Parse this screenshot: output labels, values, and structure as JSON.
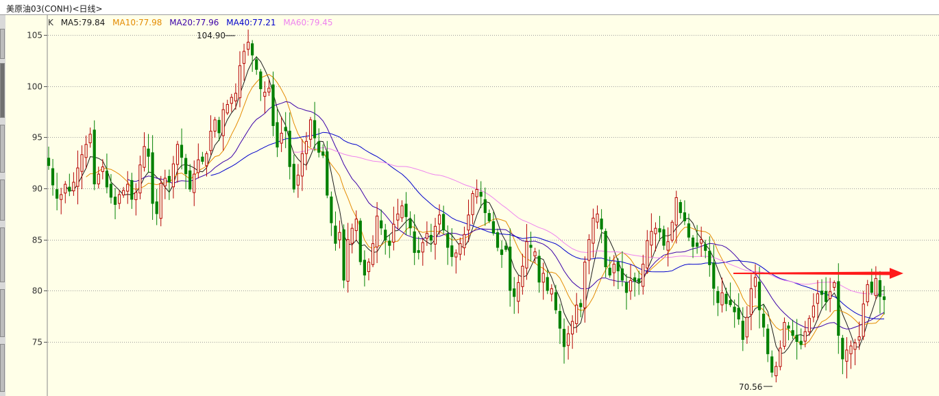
{
  "window": {
    "title": "美原油03(CONH)<日线>"
  },
  "legend": {
    "k_label": "K",
    "items": [
      {
        "label": "MA5:79.84",
        "color": "#1a1a1a"
      },
      {
        "label": "MA10:77.98",
        "color": "#e38b00"
      },
      {
        "label": "MA20:77.96",
        "color": "#3b00a8"
      },
      {
        "label": "MA40:77.21",
        "color": "#0000cc"
      },
      {
        "label": "MA60:79.45",
        "color": "#ee82ee"
      }
    ]
  },
  "colors": {
    "background": "#ffffe8",
    "up_candle": "#b50000",
    "down_candle": "#008000",
    "grid": "#9c9c9c",
    "arrow": "#ff1a1a"
  },
  "chart_data": {
    "type": "candlestick",
    "title": "美原油03(CONH)<日线>",
    "ylim": [
      70,
      106
    ],
    "y_ticks": [
      105,
      100,
      95,
      90,
      85,
      80,
      75
    ],
    "grid": "horizontal dotted",
    "annotations": [
      {
        "text": "104.90",
        "role": "period high"
      },
      {
        "text": "70.56",
        "role": "period low"
      },
      {
        "text": "",
        "role": "red horizontal arrow pointing right near 81.7"
      }
    ],
    "close": [
      92.2,
      90.3,
      89.0,
      89.4,
      90.4,
      89.7,
      90.6,
      92.0,
      93.3,
      94.3,
      95.3,
      90.4,
      91.4,
      92.1,
      90.1,
      89.1,
      88.4,
      89.4,
      89.8,
      90.4,
      88.9,
      89.6,
      92.3,
      94.1,
      93.1,
      88.5,
      87.5,
      90.5,
      91.0,
      90.6,
      92.4,
      94.3,
      93.0,
      91.4,
      89.9,
      91.4,
      92.8,
      92.6,
      93.4,
      95.6,
      96.7,
      95.4,
      97.7,
      98.2,
      98.9,
      99.3,
      102.0,
      103.4,
      104.3,
      103.0,
      101.6,
      99.7,
      99.4,
      99.8,
      96.1,
      94.0,
      95.4,
      95.6,
      92.1,
      89.9,
      91.3,
      93.4,
      94.6,
      96.7,
      94.9,
      93.5,
      93.2,
      89.3,
      86.6,
      84.6,
      85.7,
      81.0,
      85.0,
      86.1,
      87.0,
      82.8,
      81.5,
      82.8,
      84.6,
      87.3,
      86.1,
      84.9,
      84.4,
      86.5,
      87.5,
      88.3,
      87.2,
      86.1,
      83.7,
      83.7,
      84.7,
      85.6,
      84.9,
      86.3,
      87.4,
      85.9,
      84.2,
      83.3,
      83.7,
      84.6,
      85.5,
      87.4,
      89.5,
      89.9,
      89.2,
      87.6,
      86.8,
      85.6,
      84.2,
      83.5,
      84.0,
      80.0,
      79.4,
      80.8,
      82.4,
      84.8,
      84.2,
      83.8,
      80.8,
      81.7,
      80.0,
      80.2,
      78.1,
      76.3,
      74.5,
      75.8,
      77.0,
      78.6,
      78.4,
      82.8,
      85.0,
      87.1,
      87.5,
      86.0,
      82.3,
      81.5,
      82.6,
      81.9,
      81.0,
      79.8,
      81.0,
      80.9,
      80.8,
      82.6,
      84.9,
      85.8,
      86.1,
      85.7,
      84.4,
      84.8,
      86.7,
      89.1,
      87.6,
      86.8,
      85.2,
      84.3,
      84.3,
      85.0,
      83.9,
      82.5,
      80.2,
      78.8,
      79.8,
      78.7,
      78.6,
      77.9,
      77.2,
      75.2,
      77.4,
      80.2,
      81.3,
      78.1,
      76.4,
      73.8,
      72.0,
      72.6,
      74.4,
      76.9,
      76.3,
      75.6,
      75.0,
      74.7,
      76.0,
      77.3,
      78.5,
      79.7,
      79.6,
      78.9,
      79.9,
      80.8,
      75.6,
      73.3,
      74.2,
      74.6,
      74.9,
      75.5,
      78.7,
      80.6,
      79.8,
      81.2,
      79.4,
      79.1
    ]
  }
}
